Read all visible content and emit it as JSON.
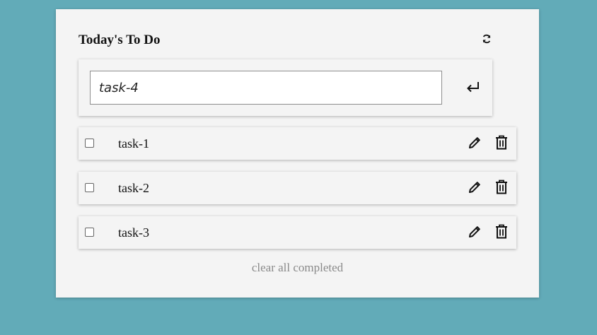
{
  "app": {
    "title": "Today's To Do"
  },
  "new_task": {
    "value": "task-4"
  },
  "tasks": [
    {
      "label": "task-1",
      "completed": false
    },
    {
      "label": "task-2",
      "completed": false
    },
    {
      "label": "task-3",
      "completed": false
    }
  ],
  "footer": {
    "clear_label": "clear all completed"
  },
  "icons": {
    "refresh": "refresh-icon",
    "enter": "enter-icon",
    "edit": "pencil-icon",
    "delete": "trash-icon"
  },
  "colors": {
    "background": "#62abb8",
    "card": "#f4f4f4",
    "muted_text": "#8a8a8a"
  }
}
